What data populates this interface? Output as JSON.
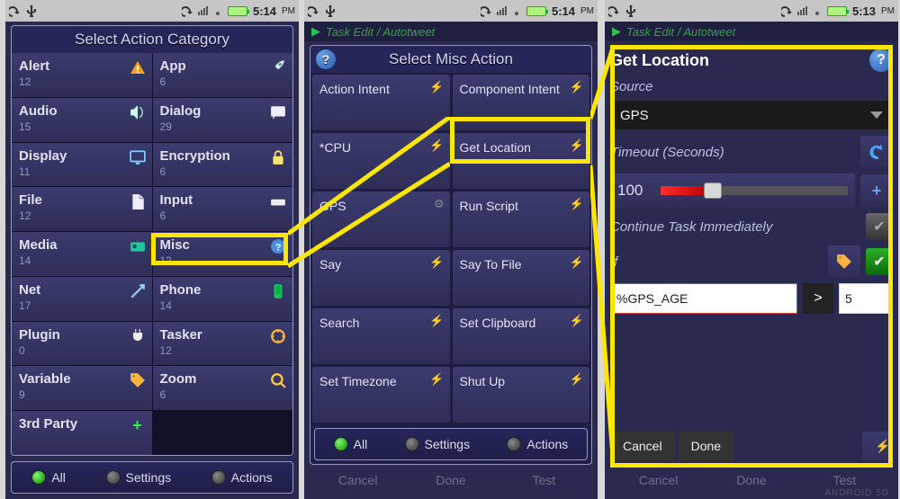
{
  "status": {
    "time": "5:14",
    "time3": "5:13",
    "pm": "PM"
  },
  "peek_title": "Task Edit / Autotweet",
  "cat_panel_title": "Select Action Category",
  "misc_panel_title": "Select Misc Action",
  "categories": [
    {
      "name": "Alert",
      "count": "12"
    },
    {
      "name": "App",
      "count": "6"
    },
    {
      "name": "Audio",
      "count": "15"
    },
    {
      "name": "Dialog",
      "count": "29"
    },
    {
      "name": "Display",
      "count": "11"
    },
    {
      "name": "Encryption",
      "count": "6"
    },
    {
      "name": "File",
      "count": "12"
    },
    {
      "name": "Input",
      "count": "6"
    },
    {
      "name": "Media",
      "count": "14"
    },
    {
      "name": "Misc",
      "count": "12"
    },
    {
      "name": "Net",
      "count": "17"
    },
    {
      "name": "Phone",
      "count": "14"
    },
    {
      "name": "Plugin",
      "count": "0"
    },
    {
      "name": "Tasker",
      "count": "12"
    },
    {
      "name": "Variable",
      "count": "9"
    },
    {
      "name": "Zoom",
      "count": "6"
    },
    {
      "name": "3rd Party",
      "count": ""
    }
  ],
  "misc_actions": [
    {
      "name": "Action Intent",
      "icon": "bolt"
    },
    {
      "name": "Component Intent",
      "icon": "bolt"
    },
    {
      "name": "*CPU",
      "icon": "bolt"
    },
    {
      "name": "Get Location",
      "icon": "bolt"
    },
    {
      "name": "GPS",
      "icon": "gear"
    },
    {
      "name": "Run Script",
      "icon": "bolt"
    },
    {
      "name": "Say",
      "icon": "bolt"
    },
    {
      "name": "Say To File",
      "icon": "bolt"
    },
    {
      "name": "Search",
      "icon": "bolt"
    },
    {
      "name": "Set Clipboard",
      "icon": "bolt"
    },
    {
      "name": "Set Timezone",
      "icon": "bolt"
    },
    {
      "name": "Shut Up",
      "icon": "bolt"
    }
  ],
  "foot": {
    "all": "All",
    "settings": "Settings",
    "actions": "Actions"
  },
  "btnrow": {
    "cancel": "Cancel",
    "done": "Done",
    "test": "Test"
  },
  "get_location": {
    "title": "Get Location",
    "source_label": "Source",
    "source_value": "GPS",
    "timeout_label": "Timeout (Seconds)",
    "timeout_value": "100",
    "continue_label": "Continue Task Immediately",
    "if_label": "If",
    "if_left": "%GPS_AGE",
    "if_op": ">",
    "if_right": "5",
    "cancel": "Cancel",
    "done": "Done"
  },
  "brand": "ANDROID 5D"
}
